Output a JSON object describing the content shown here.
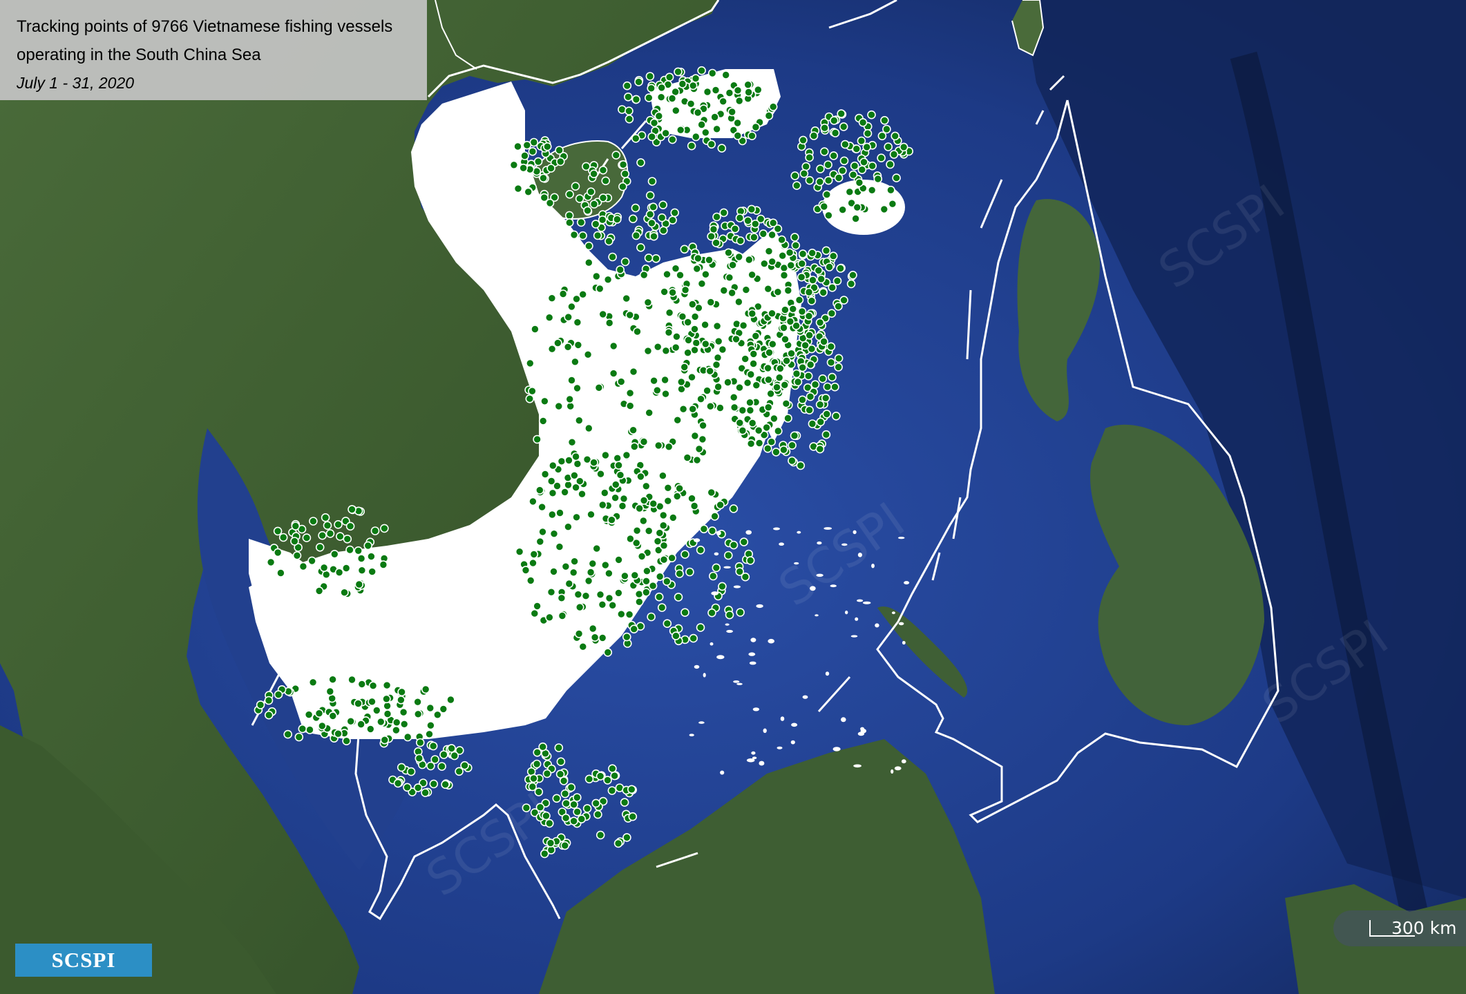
{
  "title": {
    "line1": "Tracking points of 9766 Vietnamese fishing vessels",
    "line2": "operating in the South China Sea",
    "date": "July 1 - 31, 2020"
  },
  "logo": {
    "text": "SCSPI"
  },
  "watermark": {
    "text": "SCSPI"
  },
  "scale_bar": {
    "label": "300 km"
  },
  "colors": {
    "sea": "#22408e",
    "deep_sea": "#0f2148",
    "land": "#3f5e33",
    "vessel_point_fill": "#0a7a12",
    "vessel_point_outline": "#ffffff",
    "boundary_line": "#ffffff",
    "logo_background": "#2c8fc5"
  }
}
